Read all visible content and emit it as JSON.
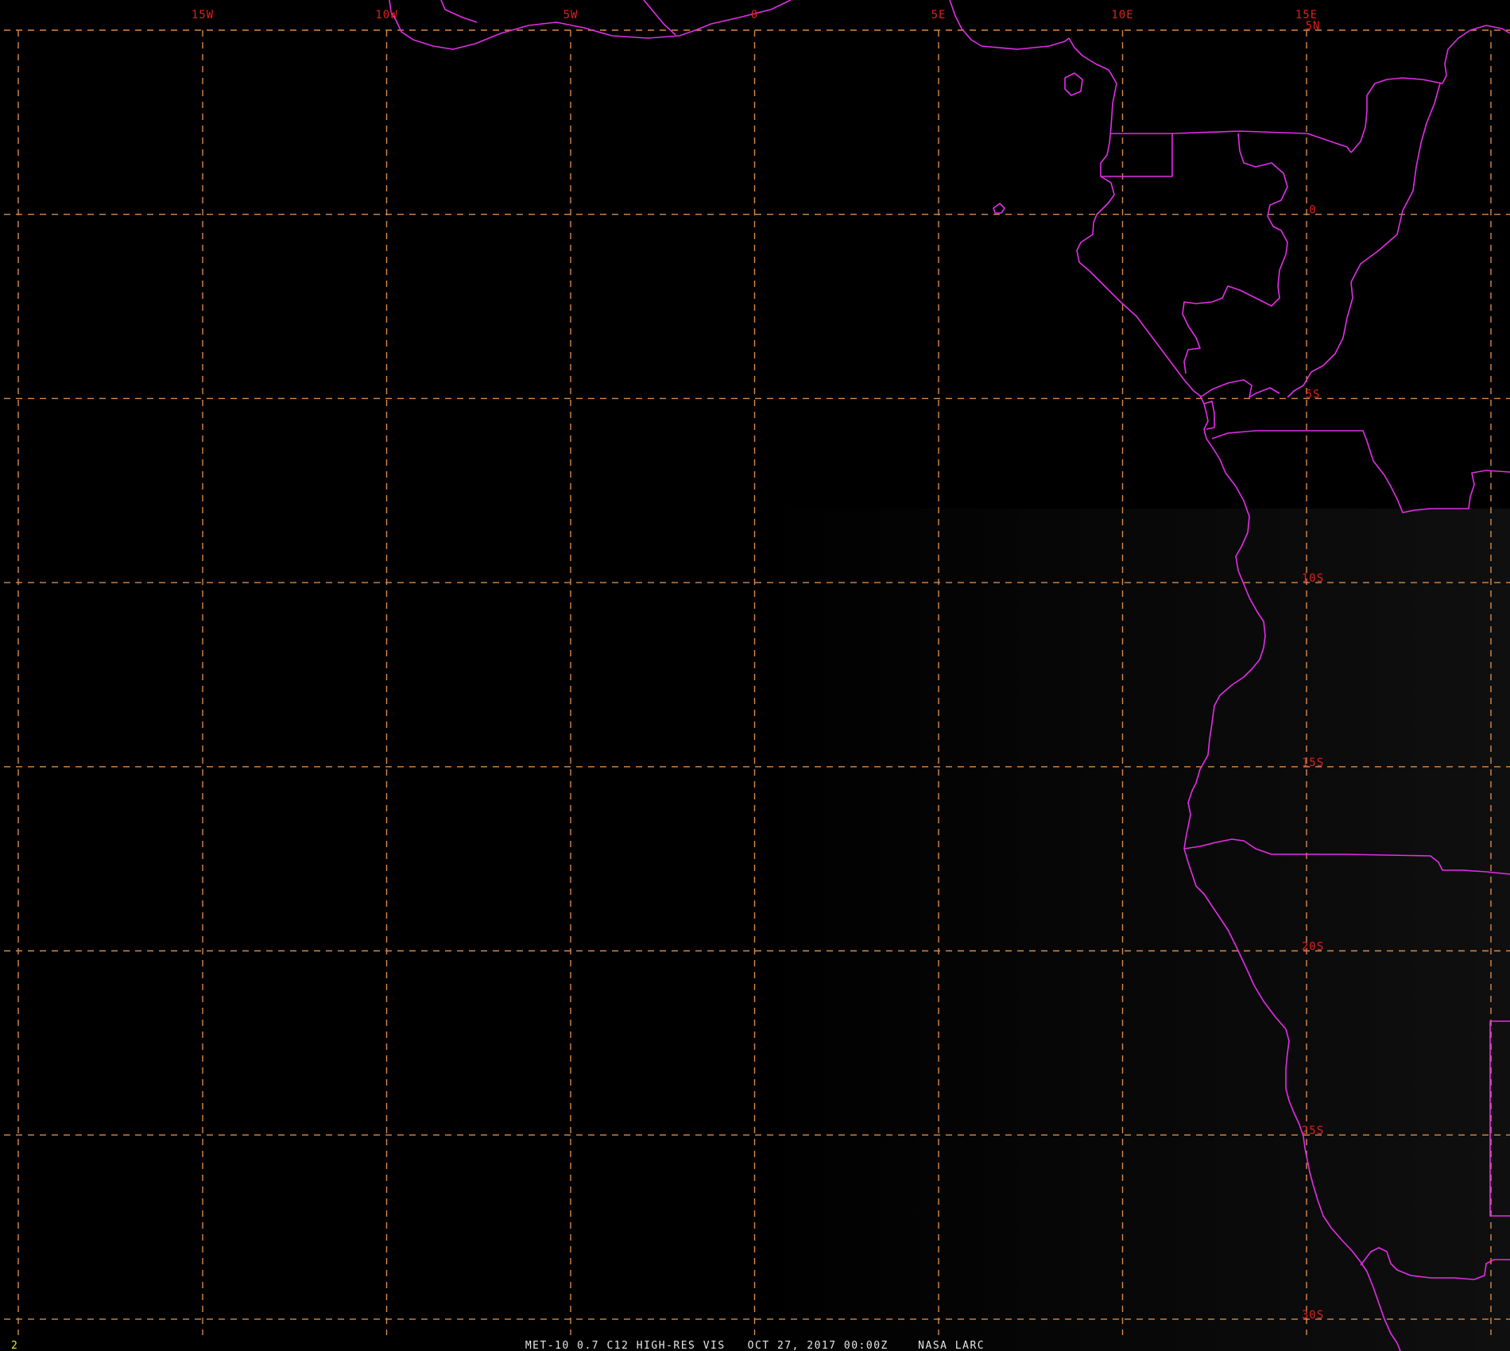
{
  "frame_number": "2",
  "caption": "MET-10 0.7 C12 HIGH-RES VIS   OCT 27, 2017 00:00Z    NASA LARC",
  "colors": {
    "background": "#000000",
    "sunlit_background": "#0d0d0d",
    "graticule": "#d88a4a",
    "coastlines": "#e22ee6",
    "grid_labels": "#e0201c",
    "caption": "#e6e6e6",
    "frame_number": "#e8e830"
  },
  "graticule": {
    "longitude_labels": [
      "15W",
      "10W",
      "5W",
      "0",
      "5E",
      "10E",
      "15E"
    ],
    "latitude_labels": [
      "5N",
      "0",
      "5S",
      "10S",
      "15S",
      "20S",
      "25S",
      "30S"
    ]
  }
}
